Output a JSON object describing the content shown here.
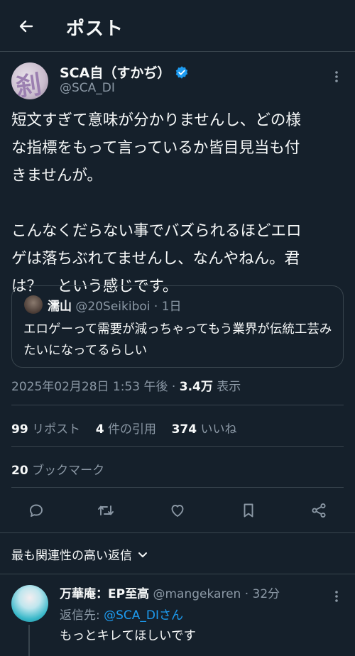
{
  "header": {
    "title": "ポスト",
    "back_icon": "arrow-left-icon"
  },
  "author": {
    "name": "SCA自（すかぢ）",
    "handle": "@SCA_DI",
    "verified": true,
    "avatar_glyph": "刹"
  },
  "tweet": {
    "text": "短文すぎて意味が分かりませんし、どの様\nな指標をもって言っているか皆目見当も付\nきませんが。\n\nこんなくだらない事でバズられるほどエロ\nゲは落ちぶれてませんし、なんやねん。君\nは？　という感じです。"
  },
  "quote": {
    "name": "濡山",
    "handle": "@20Seikiboi",
    "sep": "·",
    "time": "1日",
    "text": "エロゲーって需要が減っちゃってもう業界が伝統工芸みたいになってるらしい"
  },
  "meta": {
    "timestamp": "2025年02月28日 1:53 午後",
    "sep": "·",
    "views": "3.4万",
    "views_label": "表示"
  },
  "stats": {
    "reposts": "99",
    "reposts_label": "リポスト",
    "quotes": "4",
    "quotes_label": "件の引用",
    "likes": "374",
    "likes_label": "いいね",
    "bookmarks": "20",
    "bookmarks_label": "ブックマーク"
  },
  "actions": [
    "reply-icon",
    "repost-icon",
    "like-icon",
    "bookmark-icon",
    "share-icon"
  ],
  "sort": {
    "label": "最も関連性の高い返信"
  },
  "reply": {
    "name": "万華庵：EP至高",
    "handle": "@mangekaren",
    "sep": "·",
    "time": "32分",
    "reply_to_label": "返信先: ",
    "reply_to_mention": "@SCA_DIさん",
    "text": "もっとキレてほしいです"
  },
  "colors": {
    "background": "#15202b",
    "text": "#f7f9f9",
    "secondary": "#8b98a5",
    "accent": "#1d9bf0",
    "border": "#38444d"
  }
}
